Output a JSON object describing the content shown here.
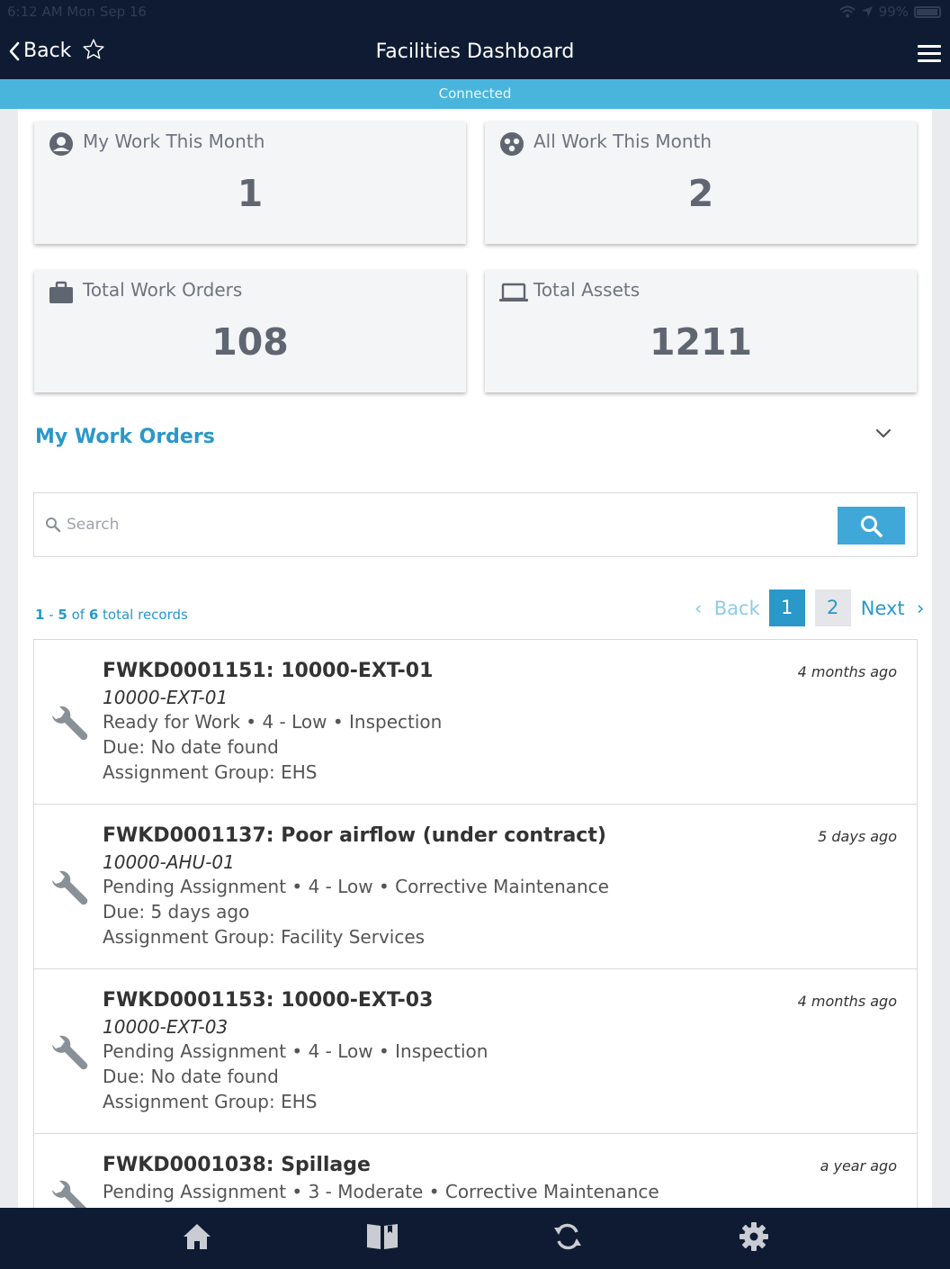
{
  "status_bar": {
    "time": "6:12 AM   Mon Sep 16",
    "battery": "99%"
  },
  "nav": {
    "back_label": "Back",
    "title": "Facilities Dashboard"
  },
  "connection": {
    "status": "Connected"
  },
  "cards": [
    {
      "label": "My Work This Month",
      "value": "1",
      "icon": "user-circle-icon"
    },
    {
      "label": "All Work This Month",
      "value": "2",
      "icon": "group-icon"
    },
    {
      "label": "Total Work Orders",
      "value": "108",
      "icon": "briefcase-icon"
    },
    {
      "label": "Total Assets",
      "value": "1211",
      "icon": "laptop-icon"
    }
  ],
  "section": {
    "title": "My Work Orders"
  },
  "search": {
    "placeholder": "Search"
  },
  "records": {
    "start": "1",
    "dash": " - ",
    "end": "5",
    "of": " of ",
    "total": "6",
    "suffix": " total records"
  },
  "pager": {
    "back_label": "Back",
    "pages": [
      "1",
      "2"
    ],
    "current": "1",
    "next_label": "Next"
  },
  "work_orders": [
    {
      "title": "FWKD0001151: 10000-EXT-01",
      "asset": "10000-EXT-01",
      "details": "Ready for Work • 4 - Low • Inspection",
      "due": "Due: No date found",
      "group": "Assignment Group: EHS",
      "ago": "4 months ago"
    },
    {
      "title": "FWKD0001137: Poor airflow (under contract)",
      "asset": "10000-AHU-01",
      "details": "Pending Assignment • 4 - Low • Corrective Maintenance",
      "due": "Due: 5 days ago",
      "group": "Assignment Group: Facility Services",
      "ago": "5 days ago"
    },
    {
      "title": "FWKD0001153: 10000-EXT-03",
      "asset": "10000-EXT-03",
      "details": "Pending Assignment • 4 - Low • Inspection",
      "due": "Due: No date found",
      "group": "Assignment Group: EHS",
      "ago": "4 months ago"
    },
    {
      "title": "FWKD0001038: Spillage",
      "details": "Pending Assignment • 3 - Moderate • Corrective Maintenance",
      "ago": "a year ago"
    }
  ],
  "tabs": [
    "home-icon",
    "book-icon",
    "sync-icon",
    "settings-gear-icon"
  ],
  "colors": {
    "nav_bg": "#0e1b33",
    "accent": "#2a98c9",
    "connected_bar": "#49b5dd"
  }
}
